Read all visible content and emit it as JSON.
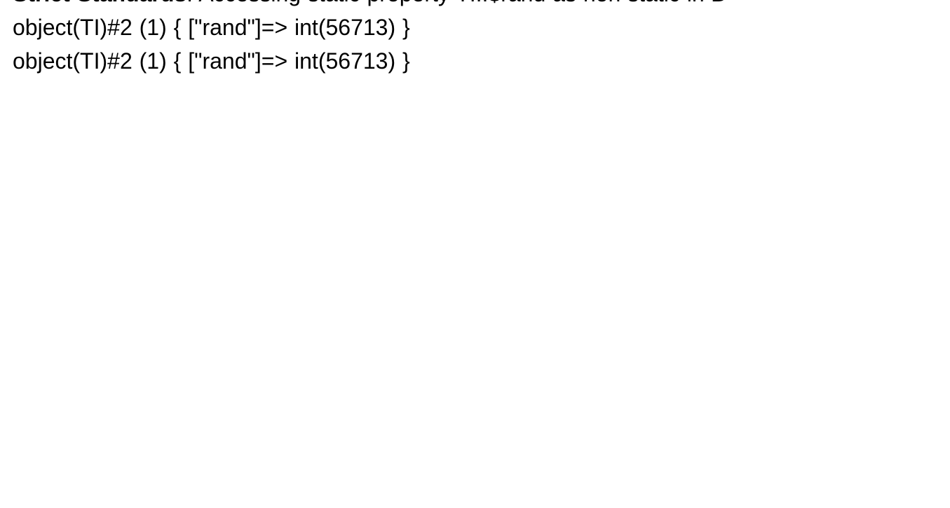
{
  "output": {
    "error": {
      "label_bold": "Strict Standards",
      "label_sep": ": ",
      "message_part1": "Accessing static property TI::$rand as non static in ",
      "message_part2_bold": "D"
    },
    "lines": [
      "object(TI)#2 (1) { [\"rand\"]=> int(56713) }",
      "object(TI)#2 (1) { [\"rand\"]=> int(56713) }"
    ]
  }
}
